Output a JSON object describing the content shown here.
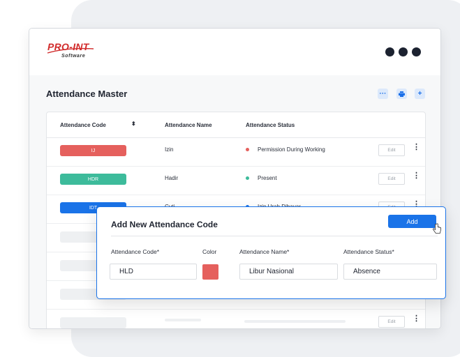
{
  "app": {
    "logo_text": "PRO-INT",
    "logo_subtext": "Software"
  },
  "page": {
    "title": "Attendance Master"
  },
  "toolbar": {
    "more_icon": "ellipsis-icon",
    "print_icon": "printer-icon",
    "add_icon": "plus-icon"
  },
  "table": {
    "headers": {
      "code": "Attendance Code",
      "name": "Attendance Name",
      "status": "Attendance Status"
    },
    "rows": [
      {
        "code": "IJ",
        "code_color": "#e5605d",
        "name": "Izin",
        "status": "Permission During Working",
        "status_color": "#e5605d",
        "edit": "Edit"
      },
      {
        "code": "HDR",
        "code_color": "#3dbb9b",
        "name": "Hadir",
        "status": "Present",
        "status_color": "#3dbb9b",
        "edit": "Edit"
      },
      {
        "code": "IDT",
        "code_color": "#1a73e8",
        "name": "Cuti",
        "status": "Izin Urah Dibayar",
        "status_color": "#1a73e8",
        "edit": "Edit"
      }
    ],
    "placeholder_edit": "Edit"
  },
  "modal": {
    "title": "Add New Attendance Code",
    "add_button": "Add",
    "labels": {
      "code": "Attendance Code*",
      "color": "Color",
      "name": "Attendance Name*",
      "status": "Attendance Status*"
    },
    "values": {
      "code": "HLD",
      "color": "#e5605d",
      "name": "Libur Nasional",
      "status": "Absence"
    }
  }
}
